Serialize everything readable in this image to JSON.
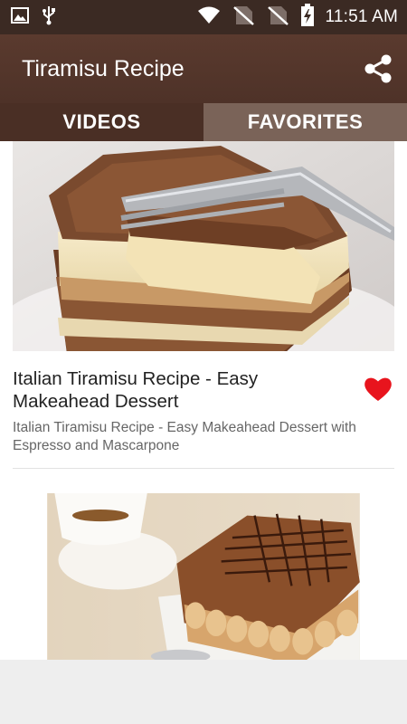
{
  "status_bar": {
    "time": "11:51 AM",
    "icons": [
      "image-icon",
      "usb-icon",
      "wifi-icon",
      "no-sim-icon",
      "no-sim-icon",
      "battery-charging-icon"
    ]
  },
  "app_bar": {
    "title": "Tiramisu Recipe",
    "share_icon": "share-icon"
  },
  "tabs": [
    {
      "label": "VIDEOS",
      "selected": true
    },
    {
      "label": "FAVORITES",
      "selected": false
    }
  ],
  "videos": [
    {
      "title": "Italian Tiramisu Recipe - Easy Makeahead Dessert",
      "description": "Italian Tiramisu Recipe - Easy Makeahead Dessert with Espresso and Mascarpone",
      "favorited": true
    }
  ],
  "colors": {
    "status_bar": "#3b2a23",
    "app_bar": "#4e3228",
    "tab_selected": "#4a2f25",
    "tab_unselected": "#7a6358",
    "heart": "#e8141d"
  }
}
